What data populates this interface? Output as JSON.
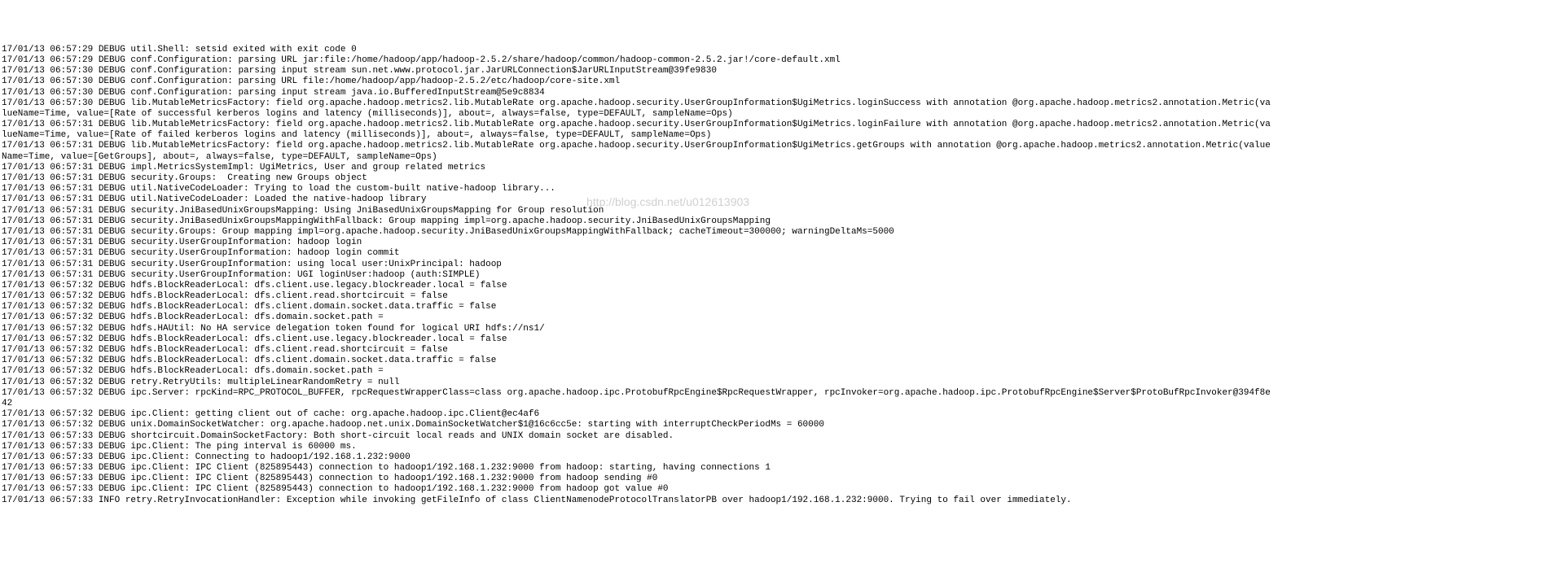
{
  "watermark": "http://blog.csdn.net/u012613903",
  "lines": [
    "17/01/13 06:57:29 DEBUG util.Shell: setsid exited with exit code 0",
    "17/01/13 06:57:29 DEBUG conf.Configuration: parsing URL jar:file:/home/hadoop/app/hadoop-2.5.2/share/hadoop/common/hadoop-common-2.5.2.jar!/core-default.xml",
    "17/01/13 06:57:30 DEBUG conf.Configuration: parsing input stream sun.net.www.protocol.jar.JarURLConnection$JarURLInputStream@39fe9830",
    "17/01/13 06:57:30 DEBUG conf.Configuration: parsing URL file:/home/hadoop/app/hadoop-2.5.2/etc/hadoop/core-site.xml",
    "17/01/13 06:57:30 DEBUG conf.Configuration: parsing input stream java.io.BufferedInputStream@5e9c8834",
    "17/01/13 06:57:30 DEBUG lib.MutableMetricsFactory: field org.apache.hadoop.metrics2.lib.MutableRate org.apache.hadoop.security.UserGroupInformation$UgiMetrics.loginSuccess with annotation @org.apache.hadoop.metrics2.annotation.Metric(va",
    "lueName=Time, value=[Rate of successful kerberos logins and latency (milliseconds)], about=, always=false, type=DEFAULT, sampleName=Ops)",
    "17/01/13 06:57:31 DEBUG lib.MutableMetricsFactory: field org.apache.hadoop.metrics2.lib.MutableRate org.apache.hadoop.security.UserGroupInformation$UgiMetrics.loginFailure with annotation @org.apache.hadoop.metrics2.annotation.Metric(va",
    "lueName=Time, value=[Rate of failed kerberos logins and latency (milliseconds)], about=, always=false, type=DEFAULT, sampleName=Ops)",
    "17/01/13 06:57:31 DEBUG lib.MutableMetricsFactory: field org.apache.hadoop.metrics2.lib.MutableRate org.apache.hadoop.security.UserGroupInformation$UgiMetrics.getGroups with annotation @org.apache.hadoop.metrics2.annotation.Metric(value",
    "Name=Time, value=[GetGroups], about=, always=false, type=DEFAULT, sampleName=Ops)",
    "17/01/13 06:57:31 DEBUG impl.MetricsSystemImpl: UgiMetrics, User and group related metrics",
    "17/01/13 06:57:31 DEBUG security.Groups:  Creating new Groups object",
    "17/01/13 06:57:31 DEBUG util.NativeCodeLoader: Trying to load the custom-built native-hadoop library...",
    "17/01/13 06:57:31 DEBUG util.NativeCodeLoader: Loaded the native-hadoop library",
    "17/01/13 06:57:31 DEBUG security.JniBasedUnixGroupsMapping: Using JniBasedUnixGroupsMapping for Group resolution",
    "17/01/13 06:57:31 DEBUG security.JniBasedUnixGroupsMappingWithFallback: Group mapping impl=org.apache.hadoop.security.JniBasedUnixGroupsMapping",
    "17/01/13 06:57:31 DEBUG security.Groups: Group mapping impl=org.apache.hadoop.security.JniBasedUnixGroupsMappingWithFallback; cacheTimeout=300000; warningDeltaMs=5000",
    "17/01/13 06:57:31 DEBUG security.UserGroupInformation: hadoop login",
    "17/01/13 06:57:31 DEBUG security.UserGroupInformation: hadoop login commit",
    "17/01/13 06:57:31 DEBUG security.UserGroupInformation: using local user:UnixPrincipal: hadoop",
    "17/01/13 06:57:31 DEBUG security.UserGroupInformation: UGI loginUser:hadoop (auth:SIMPLE)",
    "17/01/13 06:57:32 DEBUG hdfs.BlockReaderLocal: dfs.client.use.legacy.blockreader.local = false",
    "17/01/13 06:57:32 DEBUG hdfs.BlockReaderLocal: dfs.client.read.shortcircuit = false",
    "17/01/13 06:57:32 DEBUG hdfs.BlockReaderLocal: dfs.client.domain.socket.data.traffic = false",
    "17/01/13 06:57:32 DEBUG hdfs.BlockReaderLocal: dfs.domain.socket.path = ",
    "17/01/13 06:57:32 DEBUG hdfs.HAUtil: No HA service delegation token found for logical URI hdfs://ns1/",
    "17/01/13 06:57:32 DEBUG hdfs.BlockReaderLocal: dfs.client.use.legacy.blockreader.local = false",
    "17/01/13 06:57:32 DEBUG hdfs.BlockReaderLocal: dfs.client.read.shortcircuit = false",
    "17/01/13 06:57:32 DEBUG hdfs.BlockReaderLocal: dfs.client.domain.socket.data.traffic = false",
    "17/01/13 06:57:32 DEBUG hdfs.BlockReaderLocal: dfs.domain.socket.path = ",
    "17/01/13 06:57:32 DEBUG retry.RetryUtils: multipleLinearRandomRetry = null",
    "17/01/13 06:57:32 DEBUG ipc.Server: rpcKind=RPC_PROTOCOL_BUFFER, rpcRequestWrapperClass=class org.apache.hadoop.ipc.ProtobufRpcEngine$RpcRequestWrapper, rpcInvoker=org.apache.hadoop.ipc.ProtobufRpcEngine$Server$ProtoBufRpcInvoker@394f8e",
    "42",
    "17/01/13 06:57:32 DEBUG ipc.Client: getting client out of cache: org.apache.hadoop.ipc.Client@ec4af6",
    "17/01/13 06:57:32 DEBUG unix.DomainSocketWatcher: org.apache.hadoop.net.unix.DomainSocketWatcher$1@16c6cc5e: starting with interruptCheckPeriodMs = 60000",
    "17/01/13 06:57:33 DEBUG shortcircuit.DomainSocketFactory: Both short-circuit local reads and UNIX domain socket are disabled.",
    "17/01/13 06:57:33 DEBUG ipc.Client: The ping interval is 60000 ms.",
    "17/01/13 06:57:33 DEBUG ipc.Client: Connecting to hadoop1/192.168.1.232:9000",
    "17/01/13 06:57:33 DEBUG ipc.Client: IPC Client (825895443) connection to hadoop1/192.168.1.232:9000 from hadoop: starting, having connections 1",
    "17/01/13 06:57:33 DEBUG ipc.Client: IPC Client (825895443) connection to hadoop1/192.168.1.232:9000 from hadoop sending #0",
    "17/01/13 06:57:33 DEBUG ipc.Client: IPC Client (825895443) connection to hadoop1/192.168.1.232:9000 from hadoop got value #0",
    "17/01/13 06:57:33 INFO retry.RetryInvocationHandler: Exception while invoking getFileInfo of class ClientNamenodeProtocolTranslatorPB over hadoop1/192.168.1.232:9000. Trying to fail over immediately."
  ]
}
